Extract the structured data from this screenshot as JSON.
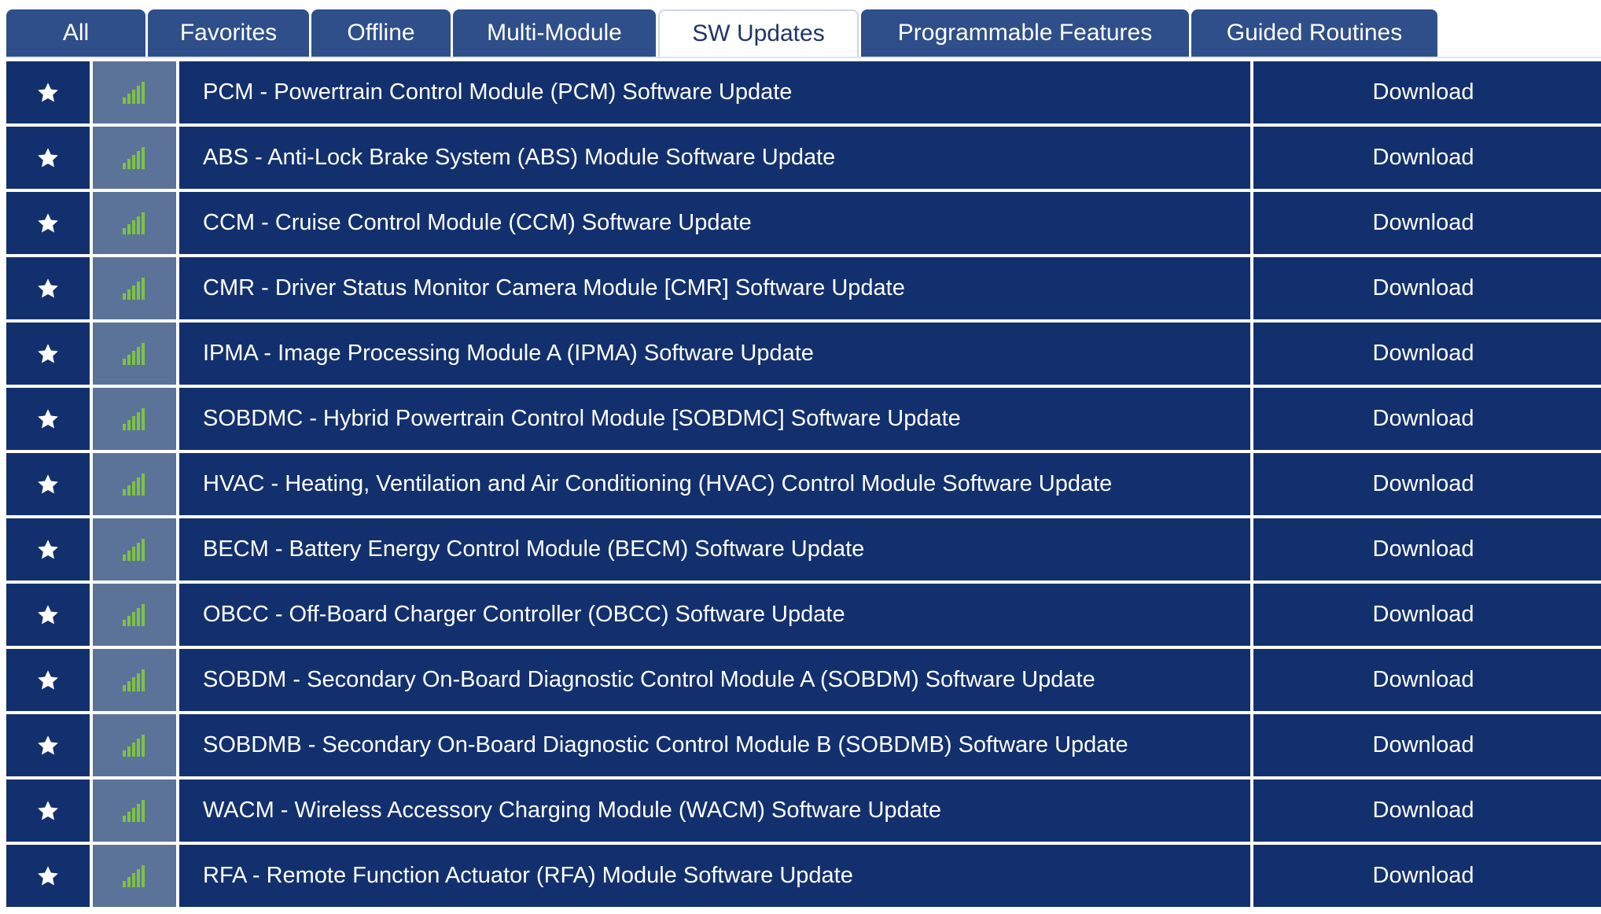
{
  "tabs": [
    {
      "label": "All",
      "active": false
    },
    {
      "label": "Favorites",
      "active": false
    },
    {
      "label": "Offline",
      "active": false
    },
    {
      "label": "Multi-Module",
      "active": false
    },
    {
      "label": "SW Updates",
      "active": true
    },
    {
      "label": "Programmable Features",
      "active": false
    },
    {
      "label": "Guided Routines",
      "active": false
    }
  ],
  "icons": {
    "favorite": "star-icon",
    "connectivity": "signal-strength-icon"
  },
  "colors": {
    "row_background": "#13306e",
    "signal_cell_background": "#5c7399",
    "tab_background": "#2f4f8a",
    "signal_bars": "#7dc242"
  },
  "rows": [
    {
      "name": "PCM - Powertrain Control Module (PCM) Software Update",
      "action": "Download"
    },
    {
      "name": "ABS - Anti-Lock Brake System (ABS) Module Software Update",
      "action": "Download"
    },
    {
      "name": "CCM - Cruise Control Module (CCM) Software Update",
      "action": "Download"
    },
    {
      "name": "CMR - Driver Status Monitor Camera Module [CMR] Software Update",
      "action": "Download"
    },
    {
      "name": "IPMA - Image Processing Module A (IPMA) Software Update",
      "action": "Download"
    },
    {
      "name": "SOBDMC - Hybrid Powertrain Control Module [SOBDMC] Software Update",
      "action": "Download"
    },
    {
      "name": "HVAC - Heating, Ventilation and Air Conditioning (HVAC) Control Module Software Update",
      "action": "Download"
    },
    {
      "name": "BECM - Battery Energy Control Module (BECM) Software Update",
      "action": "Download"
    },
    {
      "name": "OBCC - Off-Board Charger Controller (OBCC) Software Update",
      "action": "Download"
    },
    {
      "name": "SOBDM - Secondary On-Board Diagnostic Control Module A (SOBDM) Software Update",
      "action": "Download"
    },
    {
      "name": "SOBDMB - Secondary On-Board Diagnostic Control Module B (SOBDMB) Software Update",
      "action": "Download"
    },
    {
      "name": "WACM - Wireless Accessory Charging Module (WACM) Software Update",
      "action": "Download"
    },
    {
      "name": "RFA - Remote Function Actuator (RFA) Module Software Update",
      "action": "Download"
    }
  ]
}
